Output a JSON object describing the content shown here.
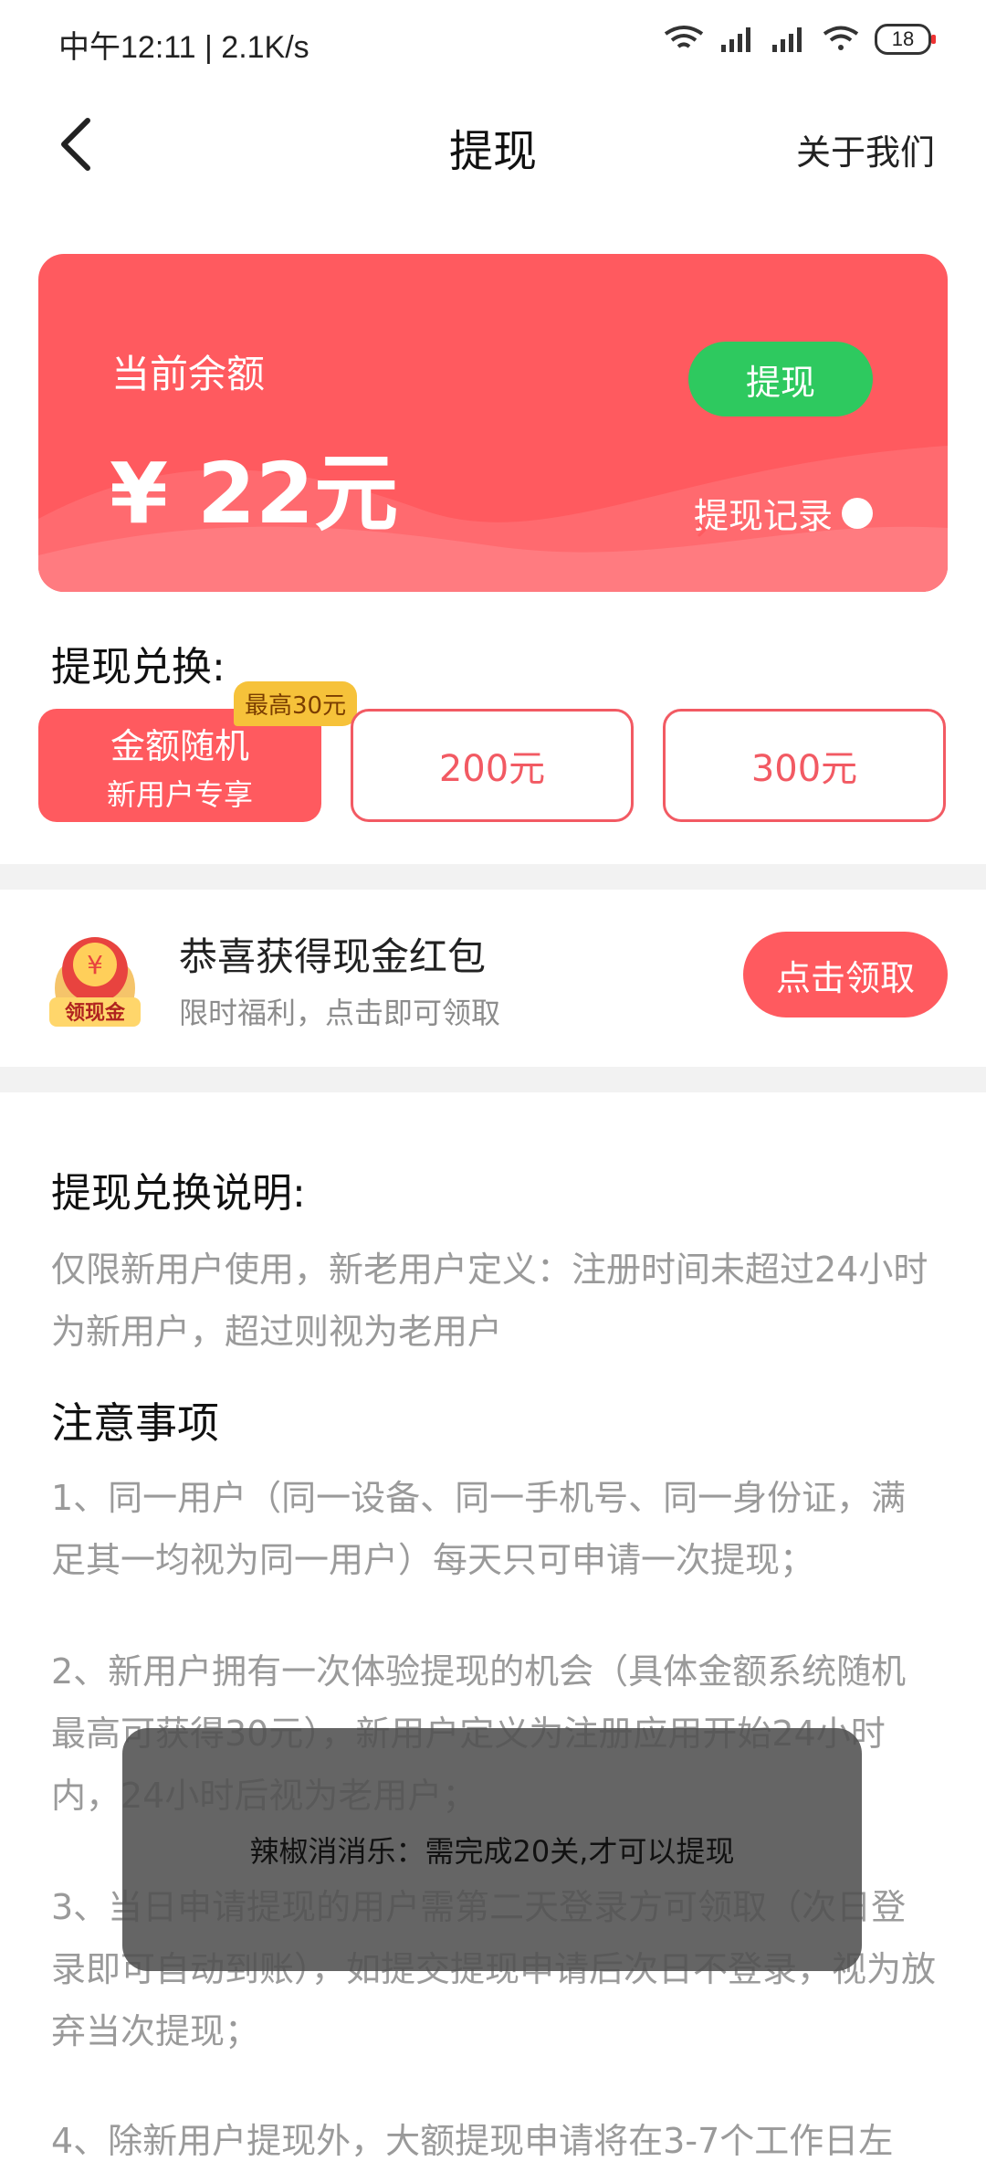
{
  "status": {
    "time": "中午12:11 | 2.1K/s",
    "battery": "18"
  },
  "nav": {
    "title": "提现",
    "about": "关于我们"
  },
  "balance": {
    "label": "当前余额",
    "amount": "¥ 22元",
    "withdraw": "提现",
    "record": "提现记录"
  },
  "exchange": {
    "title": "提现兑换:",
    "random": {
      "line1": "金额随机",
      "line2": "新用户专享",
      "badge": "最高30元"
    },
    "opt200": "200元",
    "opt300": "300元"
  },
  "redpack": {
    "icon_label": "领现金",
    "title": "恭喜获得现金红包",
    "sub": "限时福利，点击即可领取",
    "claim": "点击领取"
  },
  "rules": {
    "title": "提现兑换说明:",
    "intro": "仅限新用户使用，新老用户定义：注册时间未超过24小时为新用户，超过则视为老用户",
    "notes_title": "注意事项",
    "n1": "1、同一用户（同一设备、同一手机号、同一身份证，满足其一均视为同一用户）每天只可申请一次提现；",
    "n2": "2、新用户拥有一次体验提现的机会（具体金额系统随机最高可获得30元），新用户定义为注册应用开始24小时内，24小时后视为老用户；",
    "n3": "3、当日申请提现的用户需第二天登录方可领取（次日登录即可自动到账），如提交提现申请后次日不登录，视为放弃当次提现；",
    "n4": "4、除新用户提现外，大额提现申请将在3-7个工作日左"
  },
  "toast": {
    "text": "辣椒消消乐：需完成20关,才可以提现"
  }
}
